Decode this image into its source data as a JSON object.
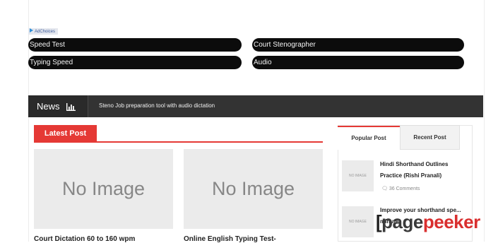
{
  "ad": {
    "adchoices_label": "AdChoices",
    "links": [
      "Speed Test",
      "Court Stenographer",
      "Typing Speed",
      "Audio"
    ]
  },
  "newsbar": {
    "label": "News",
    "ticker": "Steno Job preparation tool with audio dictation"
  },
  "latest": {
    "tab_label": "Latest Post",
    "posts": [
      {
        "image_text": "No Image",
        "title": "Court Dictation 60 to 160 wpm"
      },
      {
        "image_text": "No Image",
        "title": "Online English Typing Test-"
      }
    ]
  },
  "sidebar": {
    "tabs": [
      "Popular Post",
      "Recent Post"
    ],
    "items": [
      {
        "thumb_text": "NO IMAGE",
        "title": "Hindi Shorthand Outlines Practice (Rishi Pranali)",
        "comments": "36 Comments"
      },
      {
        "thumb_text": "NO IMAGE",
        "title": "Improve your shorthand spe... minute",
        "comments": ""
      }
    ]
  },
  "watermark": {
    "bracket": "[",
    "page": "page",
    "peeker": "peeker"
  },
  "colors": {
    "accent": "#e53935",
    "newsbar": "#333333",
    "pill": "#0c0c0c",
    "placeholder": "#ebebeb"
  }
}
